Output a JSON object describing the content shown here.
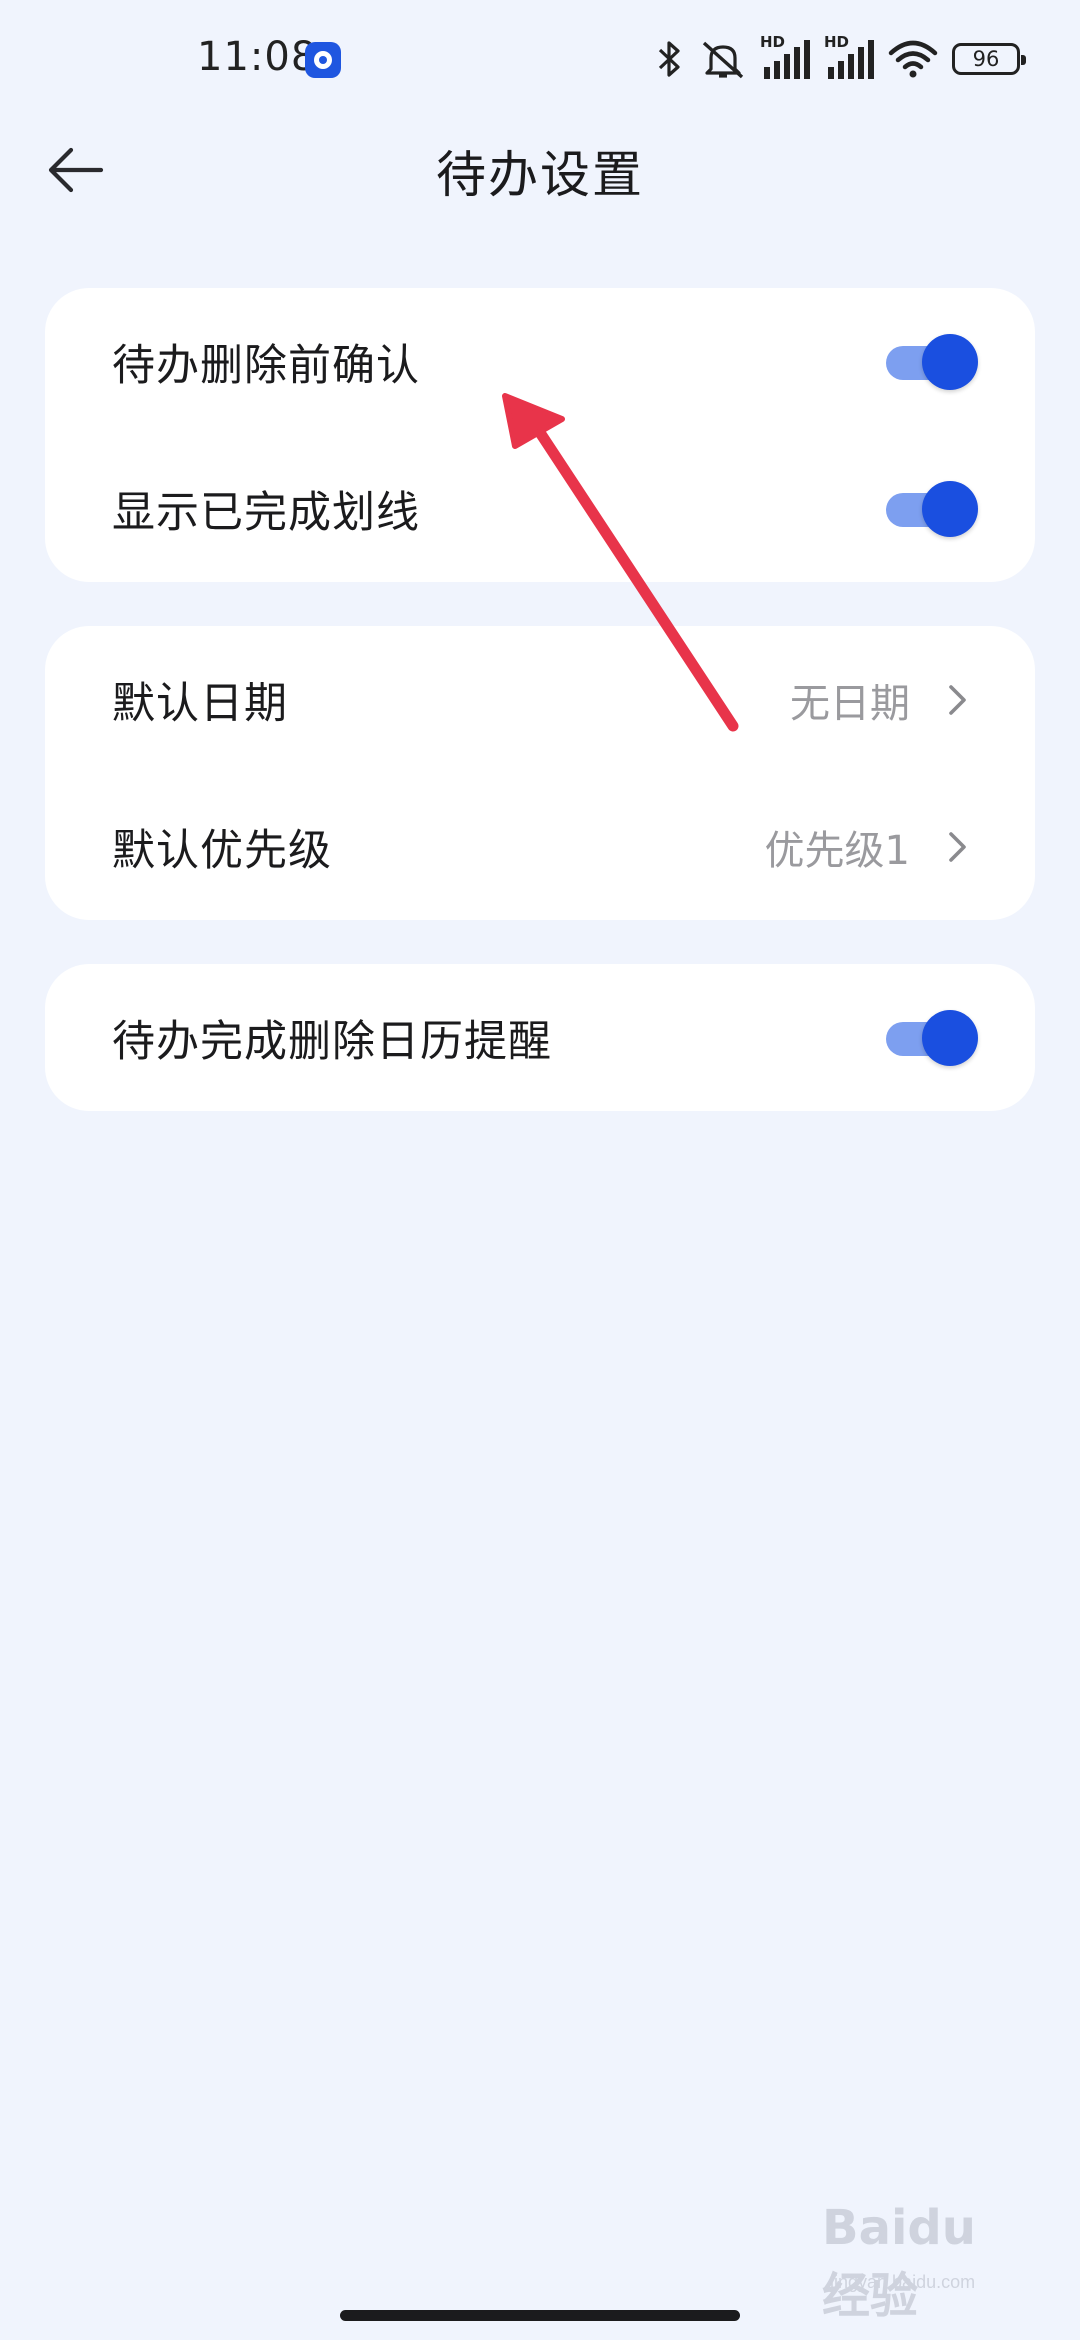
{
  "status_bar": {
    "time": "11:08",
    "battery": "96",
    "network_labels": [
      "HD",
      "HD"
    ],
    "icons": [
      "app-notification-icon",
      "bluetooth-icon",
      "mute-icon",
      "signal-icon",
      "signal-icon",
      "wifi-icon",
      "battery-icon"
    ]
  },
  "header": {
    "title": "待办设置",
    "back_icon": "arrow-left-icon"
  },
  "groups": [
    {
      "rows": [
        {
          "label": "待办删除前确认",
          "type": "toggle",
          "on": true
        },
        {
          "label": "显示已完成划线",
          "type": "toggle",
          "on": true
        }
      ]
    },
    {
      "rows": [
        {
          "label": "默认日期",
          "type": "select",
          "value": "无日期"
        },
        {
          "label": "默认优先级",
          "type": "select",
          "value": "优先级1"
        }
      ]
    },
    {
      "rows": [
        {
          "label": "待办完成删除日历提醒",
          "type": "toggle",
          "on": true
        }
      ]
    }
  ],
  "watermark": {
    "text": "Baidu经验",
    "sub": "jingyan.baidu.com"
  },
  "colors": {
    "background": "#f0f4fd",
    "card": "#ffffff",
    "toggle_knob": "#1a4fe0",
    "toggle_track": "#7d9ff0",
    "annotation_arrow": "#e8344a",
    "secondary_text": "#9a9a9e"
  }
}
